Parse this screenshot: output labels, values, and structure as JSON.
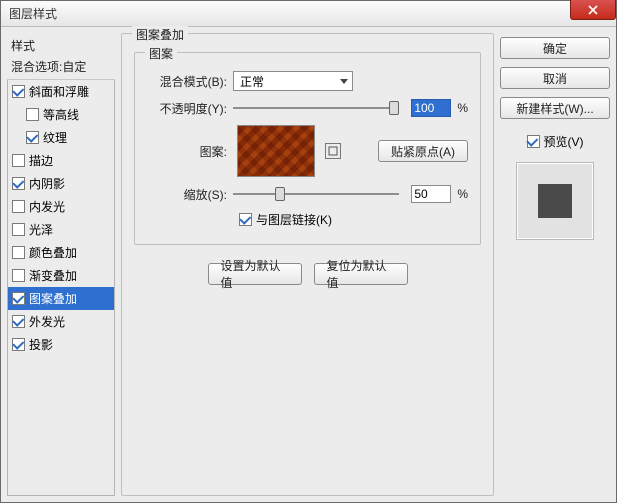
{
  "window": {
    "title": "图层样式"
  },
  "sidebar": {
    "header": "样式",
    "sub": "混合选项:自定",
    "items": [
      {
        "label": "斜面和浮雕",
        "checked": true,
        "indent": false
      },
      {
        "label": "等高线",
        "checked": false,
        "indent": true
      },
      {
        "label": "纹理",
        "checked": true,
        "indent": true
      },
      {
        "label": "描边",
        "checked": false,
        "indent": false
      },
      {
        "label": "内阴影",
        "checked": true,
        "indent": false
      },
      {
        "label": "内发光",
        "checked": false,
        "indent": false
      },
      {
        "label": "光泽",
        "checked": false,
        "indent": false
      },
      {
        "label": "颜色叠加",
        "checked": false,
        "indent": false
      },
      {
        "label": "渐变叠加",
        "checked": false,
        "indent": false
      },
      {
        "label": "图案叠加",
        "checked": true,
        "indent": false,
        "selected": true
      },
      {
        "label": "外发光",
        "checked": true,
        "indent": false
      },
      {
        "label": "投影",
        "checked": true,
        "indent": false
      }
    ]
  },
  "panel": {
    "outer_title": "图案叠加",
    "inner_title": "图案",
    "blend_label": "混合模式(B):",
    "blend_value": "正常",
    "opacity_label": "不透明度(Y):",
    "opacity_value": "100",
    "pattern_label": "图案:",
    "snap_label": "贴紧原点(A)",
    "scale_label": "缩放(S):",
    "scale_value": "50",
    "percent": "%",
    "link_label": "与图层链接(K)",
    "default_btn": "设置为默认值",
    "reset_btn": "复位为默认值"
  },
  "right": {
    "ok": "确定",
    "cancel": "取消",
    "newstyle": "新建样式(W)...",
    "preview": "预览(V)"
  }
}
